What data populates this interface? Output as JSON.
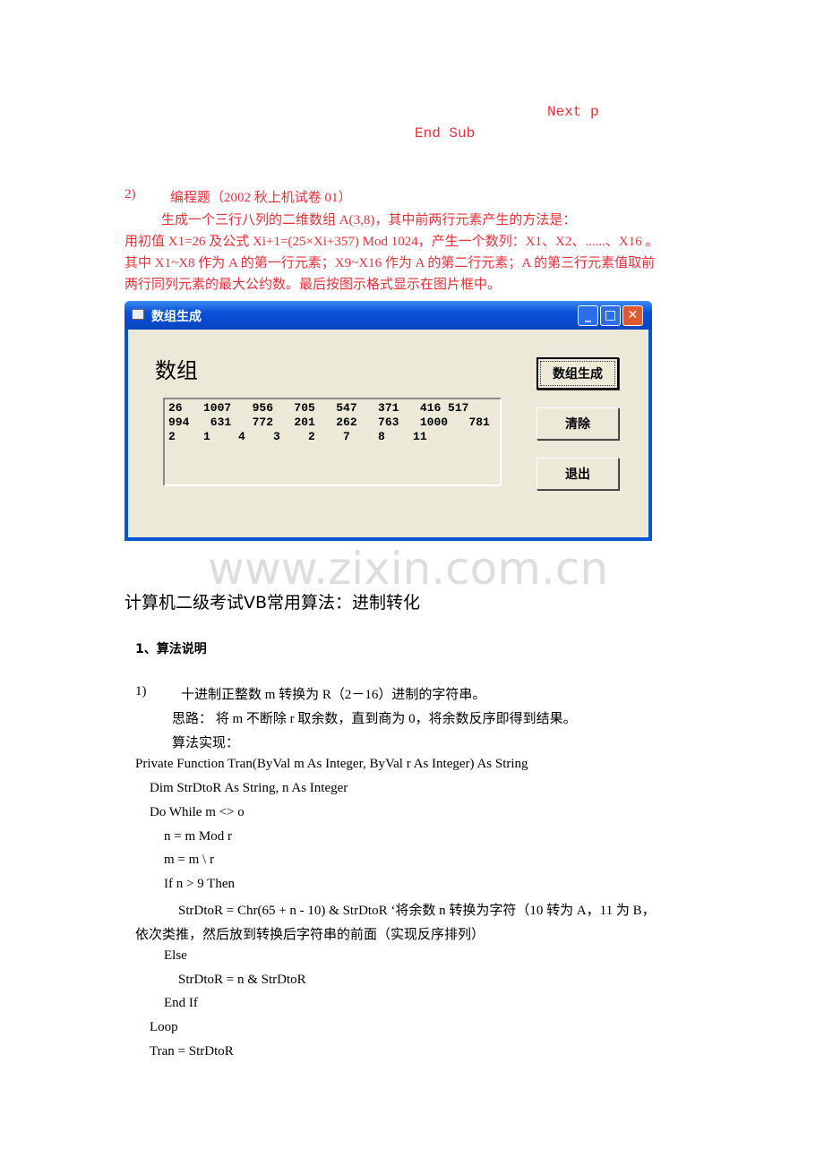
{
  "code_tail": [
    "Next p",
    "End Sub"
  ],
  "problem": {
    "number": "2)",
    "title": "编程题（2002 秋上机试卷 01）",
    "lines": [
      "生成一个三行八列的二维数组 A(3,8)，其中前两行元素产生的方法是：",
      "用初值 X1=26 及公式 Xi+1=(25×Xi+357) Mod 1024，产生一个数列：X1、X2、......、X16 。",
      "其中 X1~X8 作为 A 的第一行元素；X9~X16 作为 A 的第二行元素；A 的第三行元素值取前",
      "两行同列元素的最大公约数。最后按图示格式显示在图片框中。"
    ]
  },
  "window": {
    "title": "数组生成",
    "label": "数组",
    "rows": [
      "26   1007   956   705   547   371   416 517",
      "994   631   772   201   262   763   1000   781",
      "2    1    4    3    2    7    8    11"
    ],
    "buttons": [
      "数组生成",
      "清除",
      "退出"
    ],
    "controls": {
      "min": "_",
      "max": "□",
      "close": "✕"
    }
  },
  "watermark": "www.zixin.com.cn",
  "section": {
    "title": "计算机二级考试VB常用算法：进制转化",
    "sub": "1、算法说明",
    "item_num": "1)",
    "item": "十进制正整数 m 转换为 R（2－16）进制的字符串。",
    "idea": "思路：  将 m 不断除 r 取余数，直到商为 0，将余数反序即得到结果。",
    "impl": "算法实现：",
    "code": [
      "Private Function Tran(ByVal m As Integer, ByVal r As Integer) As String",
      "Dim StrDtoR As String, n As Integer",
      "Do While m <> o",
      "n = m Mod r",
      "m = m \\ r",
      "If n > 9 Then",
      "StrDtoR = Chr(65 + n - 10) & StrDtoR   ‘将余数 n 转换为字符（10 转为 A，11 为 B，",
      "依次类推，然后放到转换后字符串的前面（实现反序排列）",
      "Else",
      "StrDtoR = n & StrDtoR",
      "End If",
      "Loop",
      "Tran = StrDtoR"
    ]
  }
}
